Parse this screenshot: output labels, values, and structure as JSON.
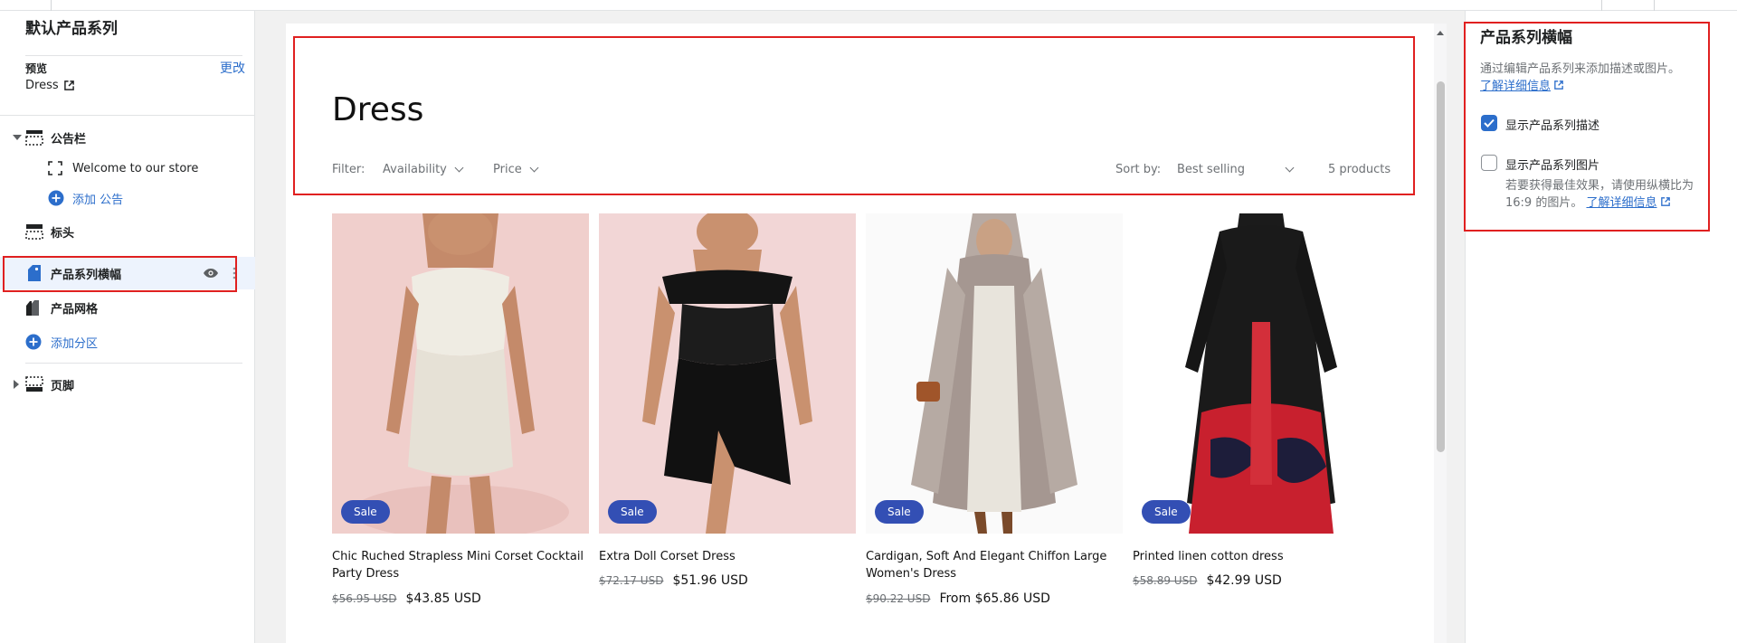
{
  "sidebar": {
    "title": "默认产品系列",
    "preview_label": "预览",
    "change_label": "更改",
    "preview_value": "Dress",
    "sections": {
      "announcement": "公告栏",
      "announcement_child": "Welcome to our store",
      "add_announcement": "添加 公告",
      "header": "标头",
      "collection_banner": "产品系列横幅",
      "product_grid": "产品网格",
      "add_section": "添加分区",
      "footer": "页脚"
    }
  },
  "preview": {
    "title": "Dress",
    "filter_label": "Filter:",
    "filter_availability": "Availability",
    "filter_price": "Price",
    "sort_label": "Sort by:",
    "sort_value": "Best selling",
    "count": "5 products",
    "sale_badge": "Sale",
    "products": [
      {
        "name": "Chic Ruched Strapless Mini Corset Cocktail Party Dress",
        "old_price": "$56.95 USD",
        "price": "$43.85 USD"
      },
      {
        "name": "Extra Doll Corset Dress",
        "old_price": "$72.17 USD",
        "price": "$51.96 USD"
      },
      {
        "name": "Cardigan, Soft And Elegant Chiffon Large Women's Dress",
        "old_price": "$90.22 USD",
        "price": "From $65.86 USD"
      },
      {
        "name": "Printed linen cotton dress",
        "old_price": "$58.89 USD",
        "price": "$42.99 USD"
      }
    ]
  },
  "settings": {
    "title": "产品系列横幅",
    "description": "通过编辑产品系列来添加描述或图片。",
    "learn_more": "了解详细信息",
    "show_description": "显示产品系列描述",
    "show_description_checked": true,
    "show_image": "显示产品系列图片",
    "show_image_checked": false,
    "image_help": "若要获得最佳效果，请使用纵横比为 16:9 的图片。",
    "learn_more_2": "了解详细信息"
  },
  "colors": {
    "accent": "#2c6ecb",
    "highlight_box": "#e02020",
    "sale_badge": "#334fb4"
  }
}
